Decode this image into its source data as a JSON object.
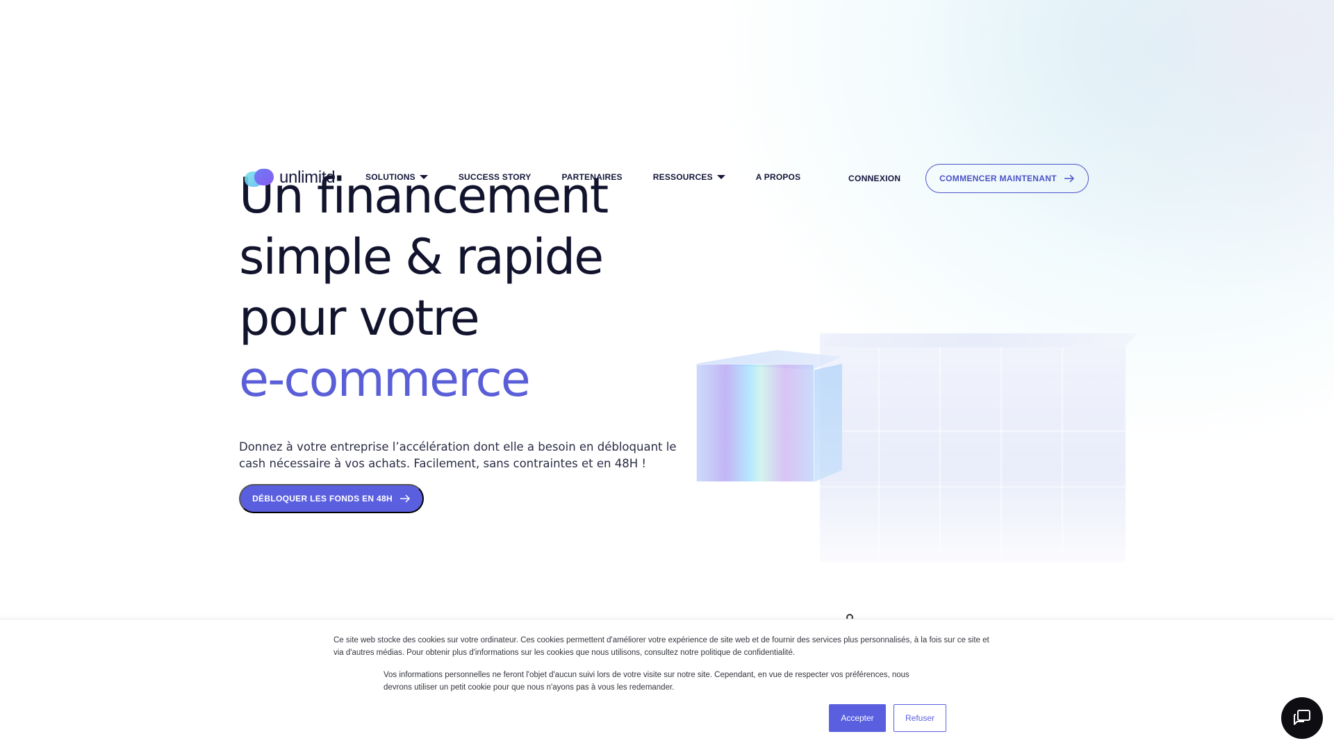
{
  "nav": {
    "logo_text": "unlimitd",
    "items": [
      {
        "label": "SOLUTIONS",
        "has_dropdown": true
      },
      {
        "label": "SUCCESS STORY",
        "has_dropdown": false
      },
      {
        "label": "PARTENAIRES",
        "has_dropdown": false
      },
      {
        "label": "RESSOURCES",
        "has_dropdown": true
      },
      {
        "label": "A PROPOS",
        "has_dropdown": false
      }
    ],
    "login_label": "CONNEXION",
    "cta_label": "COMMENCER MAINTENANT"
  },
  "hero": {
    "title_lines": [
      "Un financement",
      "simple & rapide",
      "pour votre"
    ],
    "title_accent": "e-commerce",
    "description": "Donnez à votre entreprise l’accélération dont elle a besoin en débloquant le cash nécessaire à vos achats. Facilement, sans contraintes et en 48H !",
    "cta_label": "DÉBLOQUER LES FONDS EN 48H"
  },
  "cookie": {
    "paragraph1": "Ce site web stocke des cookies sur votre ordinateur. Ces cookies permettent d'améliorer votre expérience de site web et de fournir des services plus personnalisés, à la fois sur ce site et via d'autres médias. Pour obtenir plus d'informations sur les cookies que nous utilisons, consultez notre politique de confidentialité.",
    "paragraph2": "Vos informations personnelles ne feront l'objet d'aucun suivi lors de votre visite sur notre site. Cependant, en vue de respecter vos préférences, nous devrons utiliser un petit cookie pour que nous n'ayons pas à vous les redemander.",
    "accept_label": "Accepter",
    "refuse_label": "Refuser"
  },
  "icons": {
    "arrow": "arrow-right-icon",
    "caret": "caret-down-icon",
    "chat": "chat-icon"
  },
  "colors": {
    "accent": "#5a5fe0",
    "title_accent": "#5a5fd8",
    "text_dark": "#12142e",
    "chat_bg": "#0d0d12"
  }
}
